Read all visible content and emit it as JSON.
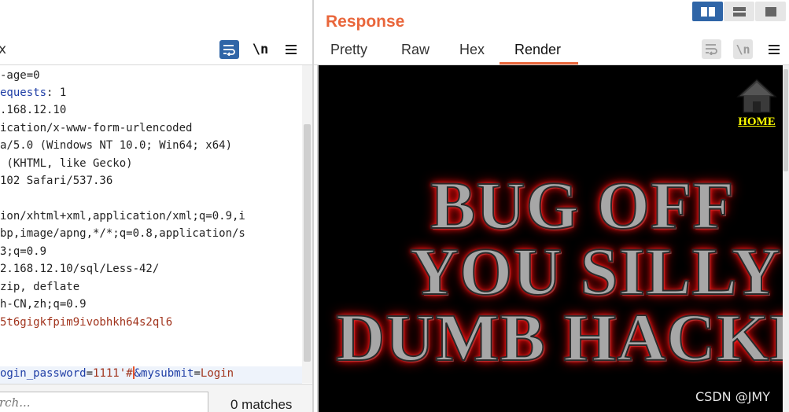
{
  "request": {
    "tab_fragment": "x",
    "toolbar": {
      "newline_label": "\\n"
    },
    "lines": [
      {
        "text": "-age=0",
        "kind": "plain"
      },
      {
        "text": "equests: 1",
        "kind": "key-tail",
        "key": "equests",
        "value": ": 1"
      },
      {
        "text": ".168.12.10",
        "kind": "plain"
      },
      {
        "text": "ication/x-www-form-urlencoded",
        "kind": "plain"
      },
      {
        "text": "a/5.0 (Windows NT 10.0; Win64; x64)",
        "kind": "plain"
      },
      {
        "text": " (KHTML, like Gecko)",
        "kind": "plain"
      },
      {
        "text": "102 Safari/537.36",
        "kind": "plain"
      },
      {
        "text": "",
        "kind": "plain"
      },
      {
        "text": "ion/xhtml+xml,application/xml;q=0.9,i",
        "kind": "plain"
      },
      {
        "text": "bp,image/apng,*/*;q=0.8,application/s",
        "kind": "plain"
      },
      {
        "text": "3;q=0.9",
        "kind": "plain"
      },
      {
        "text": "2.168.12.10/sql/Less-42/",
        "kind": "plain"
      },
      {
        "text": "zip, deflate",
        "kind": "plain"
      },
      {
        "text": "h-CN,zh;q=0.9",
        "kind": "plain"
      },
      {
        "text": "5t6gigkfpim9ivobhkh64s2ql6",
        "kind": "cookie"
      },
      {
        "text": "",
        "kind": "plain"
      },
      {
        "text": "",
        "kind": "plain"
      }
    ],
    "body_line": {
      "key1": "ogin_password",
      "val1": "1111'#",
      "key2": "&mysubmit",
      "val2": "Login"
    },
    "search": {
      "placeholder": "rch...",
      "matches": "0 matches"
    }
  },
  "response": {
    "title": "Response",
    "tabs": [
      "Pretty",
      "Raw",
      "Hex",
      "Render"
    ],
    "active_tab": "Render",
    "toolbar": {
      "newline_label": "\\n"
    },
    "render": {
      "home_label": "HOME",
      "banner_lines": [
        "BUG OFF",
        "YOU SILLY",
        "DUMB HACKER"
      ]
    }
  },
  "watermark": "CSDN @JMY",
  "colors": {
    "accent_orange": "#e9663b",
    "active_blue": "#2f65a7",
    "header_key_blue": "#1f3ea6",
    "value_red": "#a1341d",
    "home_yellow": "#ffff00",
    "banner_glow_red": "#ff1a1a"
  }
}
